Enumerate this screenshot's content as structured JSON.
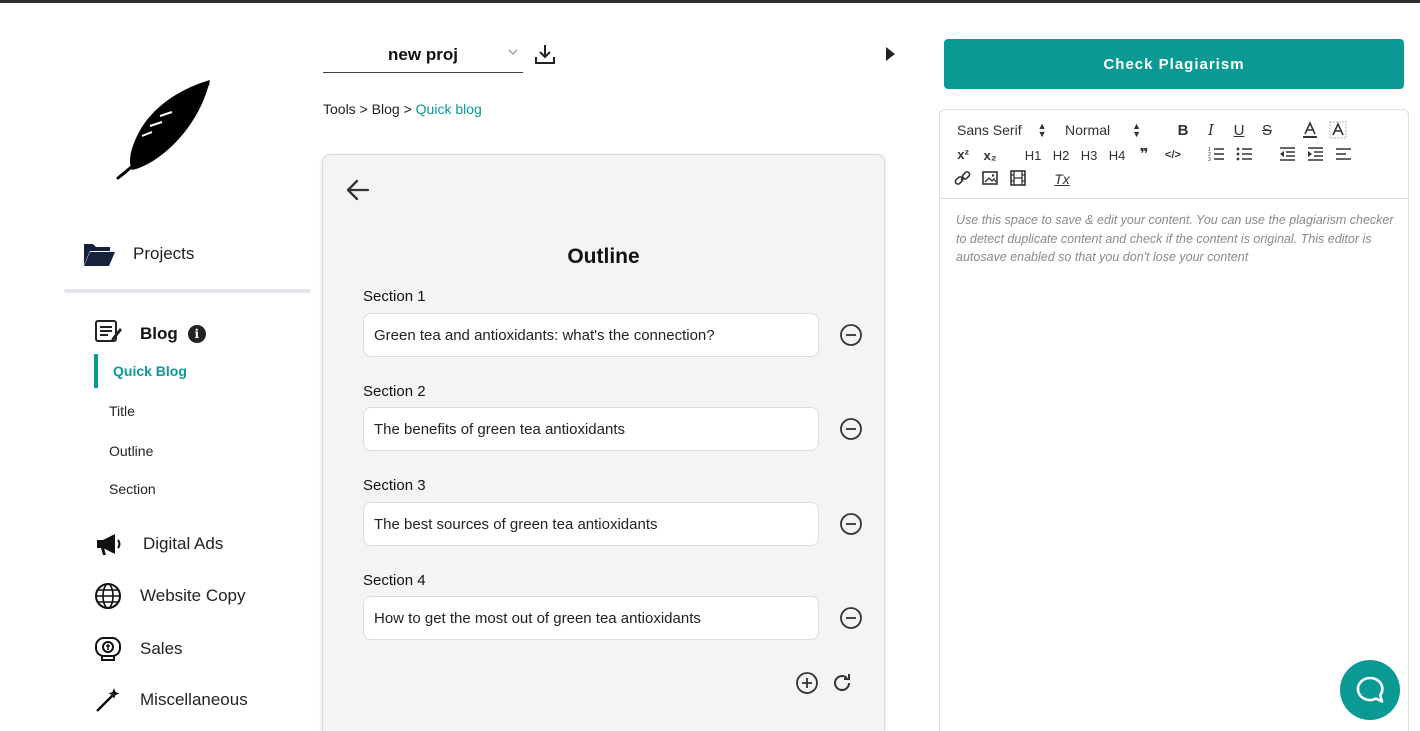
{
  "project": {
    "name": "new proj"
  },
  "breadcrumb": {
    "tools": "Tools",
    "sep1": " > ",
    "blog": "Blog",
    "sep2": " > ",
    "current": "Quick blog"
  },
  "sidebar": {
    "projects_label": "Projects",
    "blog_label": "Blog",
    "info_glyph": "i",
    "blog_items": [
      {
        "label": "Quick Blog",
        "active": true
      },
      {
        "label": "Title"
      },
      {
        "label": "Outline"
      },
      {
        "label": "Section"
      }
    ],
    "categories": [
      {
        "label": "Digital Ads",
        "icon": "megaphone-icon"
      },
      {
        "label": "Website Copy",
        "icon": "globe-icon"
      },
      {
        "label": "Sales",
        "icon": "sales-icon"
      },
      {
        "label": "Miscellaneous",
        "icon": "magic-wand-icon"
      }
    ]
  },
  "outline": {
    "title": "Outline",
    "sections": [
      {
        "label": "Section 1",
        "value": "Green tea and antioxidants: what's the connection?"
      },
      {
        "label": "Section 2",
        "value": "The benefits of green tea antioxidants"
      },
      {
        "label": "Section 3",
        "value": "The best sources of green tea antioxidants"
      },
      {
        "label": "Section 4",
        "value": "How to get the most out of green tea antioxidants"
      }
    ]
  },
  "editor": {
    "check_button": "Check Plagiarism",
    "font_select": "Sans Serif",
    "size_select": "Normal",
    "placeholder": "Use this space to save & edit your content. You can use the plagiarism checker to detect duplicate content and check if the content is original. This editor is autosave enabled so that you don't lose your content",
    "toolbar": {
      "bold": "B",
      "italic": "I",
      "underline": "U",
      "strike": "S",
      "h1": "H1",
      "h2": "H2",
      "h3": "H3",
      "h4": "H4",
      "quote": "❞",
      "code": "</>",
      "superscript": "x²",
      "subscript": "x₂",
      "clear_format": "Tx"
    }
  },
  "colors": {
    "accent": "#0a9a93",
    "text": "#111111",
    "card_bg": "#f3f4f6"
  }
}
